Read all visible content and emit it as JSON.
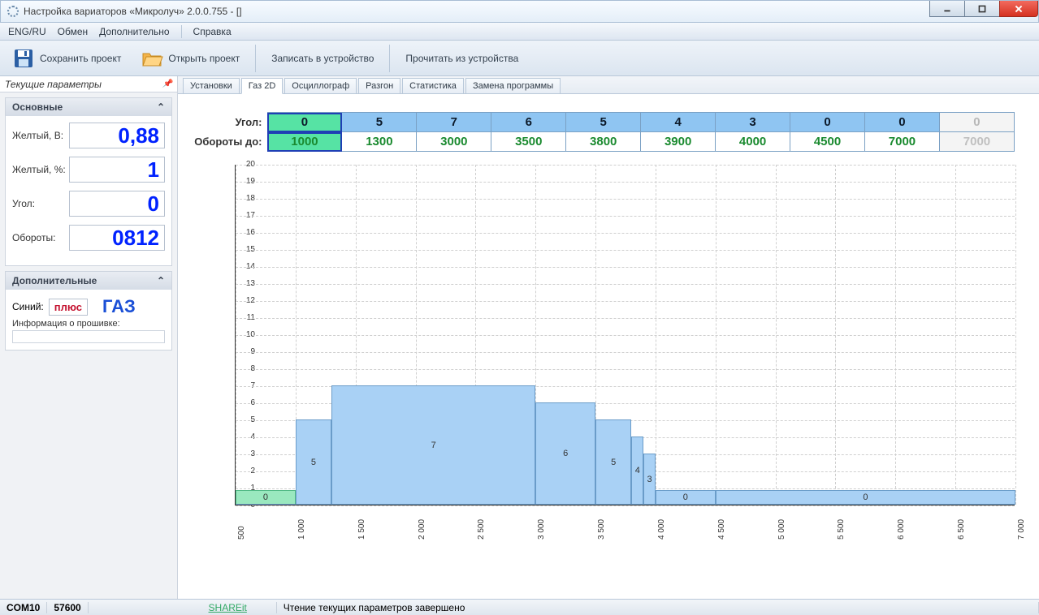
{
  "window": {
    "title": "Настройка вариаторов «Микролуч» 2.0.0.755 - []"
  },
  "menu": {
    "lang": "ENG/RU",
    "exchange": "Обмен",
    "extra": "Дополнительно",
    "help": "Справка"
  },
  "toolbar": {
    "save": "Сохранить проект",
    "open": "Открыть проект",
    "write": "Записать в устройство",
    "read": "Прочитать из устройства"
  },
  "sidebar": {
    "title": "Текущие параметры",
    "main": {
      "title": "Основные",
      "yellow_v_label": "Желтый, В:",
      "yellow_v": "0,88",
      "yellow_pct_label": "Желтый, %:",
      "yellow_pct": "1",
      "angle_label": "Угол:",
      "angle": "0",
      "rpm_label": "Обороты:",
      "rpm": "0812"
    },
    "extra": {
      "title": "Дополнительные",
      "blue_label": "Синий:",
      "blue_value": "плюс",
      "gas": "ГАЗ",
      "fw_label": "Информация о прошивке:"
    }
  },
  "tabs": [
    "Установки",
    "Газ 2D",
    "Осциллограф",
    "Разгон",
    "Статистика",
    "Замена программы"
  ],
  "active_tab": 1,
  "grid": {
    "angle_label": "Угол:",
    "rpm_label": "Обороты до:",
    "angles": [
      "0",
      "5",
      "7",
      "6",
      "5",
      "4",
      "3",
      "0",
      "0",
      "0"
    ],
    "rpms": [
      "1000",
      "1300",
      "3000",
      "3500",
      "3800",
      "3900",
      "4000",
      "4500",
      "7000",
      "7000"
    ]
  },
  "chart_data": {
    "type": "bar",
    "title": "",
    "xlabel": "",
    "ylabel": "",
    "ylim": [
      0,
      20
    ],
    "x_ticks": [
      500,
      1000,
      1500,
      2000,
      2500,
      3000,
      3500,
      4000,
      4500,
      5000,
      5500,
      6000,
      6500,
      7000
    ],
    "x_min": 500,
    "x_max": 7000,
    "segments": [
      {
        "from": 500,
        "to": 1000,
        "value": 0
      },
      {
        "from": 1000,
        "to": 1300,
        "value": 5
      },
      {
        "from": 1300,
        "to": 3000,
        "value": 7
      },
      {
        "from": 3000,
        "to": 3500,
        "value": 6
      },
      {
        "from": 3500,
        "to": 3800,
        "value": 5
      },
      {
        "from": 3800,
        "to": 3900,
        "value": 4
      },
      {
        "from": 3900,
        "to": 4000,
        "value": 3
      },
      {
        "from": 4000,
        "to": 4500,
        "value": 0
      },
      {
        "from": 4500,
        "to": 7000,
        "value": 0
      }
    ]
  },
  "status": {
    "com": "COM10",
    "baud": "57600",
    "share": "SHAREit",
    "msg": "Чтение текущих параметров завершено"
  }
}
